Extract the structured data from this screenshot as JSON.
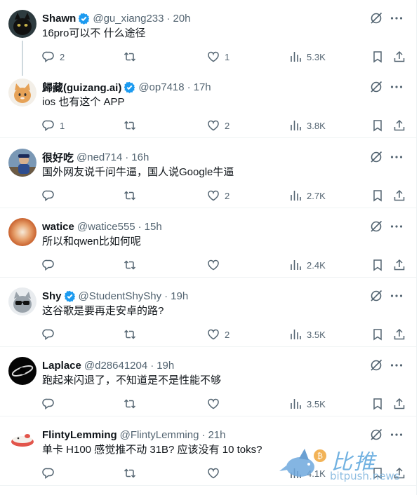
{
  "tweets": [
    {
      "name": "Shawn",
      "verified": true,
      "handle": "@gu_xiang233",
      "time": "20h",
      "text": "16pro可以不 什么途径",
      "replies": "2",
      "retweets": "",
      "likes": "1",
      "views": "5.3K"
    },
    {
      "name": "歸藏(guizang.ai)",
      "verified": true,
      "handle": "@op7418",
      "time": "17h",
      "text": "ios 也有这个 APP",
      "replies": "1",
      "retweets": "",
      "likes": "2",
      "views": "3.8K"
    },
    {
      "name": "很好吃",
      "verified": false,
      "handle": "@ned714",
      "time": "16h",
      "text": "国外网友说千问牛逼，国人说Google牛逼",
      "replies": "",
      "retweets": "",
      "likes": "2",
      "views": "2.7K"
    },
    {
      "name": "watice",
      "verified": false,
      "handle": "@watice555",
      "time": "15h",
      "text": "所以和qwen比如何呢",
      "replies": "",
      "retweets": "",
      "likes": "",
      "views": "2.4K"
    },
    {
      "name": "Shy",
      "verified": true,
      "handle": "@StudentShyShy",
      "time": "19h",
      "text": "这谷歌是要再走安卓的路?",
      "replies": "",
      "retweets": "",
      "likes": "2",
      "views": "3.5K"
    },
    {
      "name": "Laplace",
      "verified": false,
      "handle": "@d28641204",
      "time": "19h",
      "text": "跑起来闪退了，不知道是不是性能不够",
      "replies": "",
      "retweets": "",
      "likes": "",
      "views": "3.5K"
    },
    {
      "name": "FlintyLemming",
      "verified": false,
      "handle": "@FlintyLemming",
      "time": "21h",
      "text": "单卡 H100 感觉推不动 31B? 应该没有 10 toks?",
      "replies": "",
      "retweets": "",
      "likes": "",
      "views": "4.1K"
    }
  ],
  "separator": "·",
  "watermark": {
    "title": "比推",
    "subtitle": "bitpush.news"
  },
  "colors": {
    "verified": "#1d9bf0",
    "muted": "#536471",
    "text": "#0f1419",
    "border": "#eff3f4"
  },
  "icons": [
    "reply-icon",
    "retweet-icon",
    "like-icon",
    "views-icon",
    "bookmark-icon",
    "share-icon",
    "grok-icon",
    "more-icon",
    "verified-badge-icon"
  ]
}
